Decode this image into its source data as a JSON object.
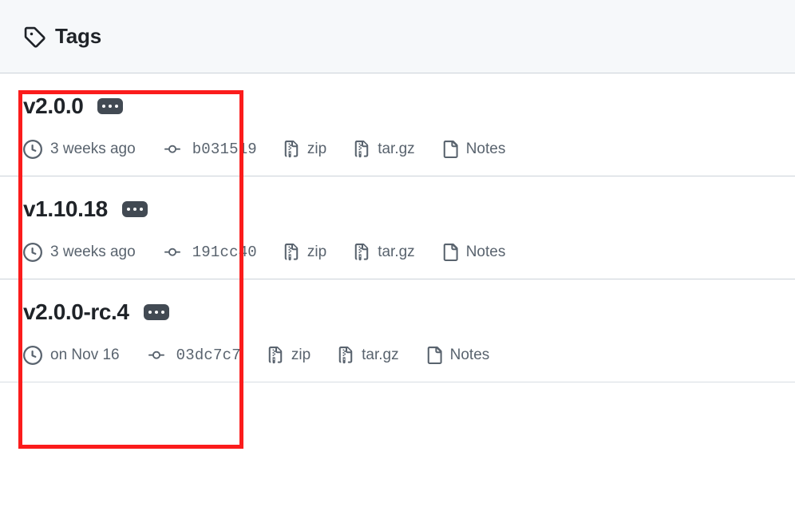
{
  "header": {
    "title": "Tags",
    "icon": "tag-icon"
  },
  "tags": [
    {
      "name": "v2.0.0",
      "menu_label": "…",
      "date": "3 weeks ago",
      "commit_sha": "b031519",
      "zip_label": "zip",
      "targz_label": "tar.gz",
      "notes_label": "Notes"
    },
    {
      "name": "v1.10.18",
      "menu_label": "…",
      "date": "3 weeks ago",
      "commit_sha": "191cc40",
      "zip_label": "zip",
      "targz_label": "tar.gz",
      "notes_label": "Notes"
    },
    {
      "name": "v2.0.0-rc.4",
      "menu_label": "…",
      "date": "on Nov 16",
      "commit_sha": "03dc7c7",
      "zip_label": "zip",
      "targz_label": "tar.gz",
      "notes_label": "Notes"
    }
  ],
  "annotation": {
    "color": "#fb1c1c",
    "shape": "rectangle"
  },
  "colors": {
    "header_bg": "#f6f8fa",
    "border": "#ccd2d9",
    "text_primary": "#1f2328",
    "text_muted": "#59636e",
    "kebab_bg": "#424a53",
    "annotation": "#fb1c1c"
  }
}
